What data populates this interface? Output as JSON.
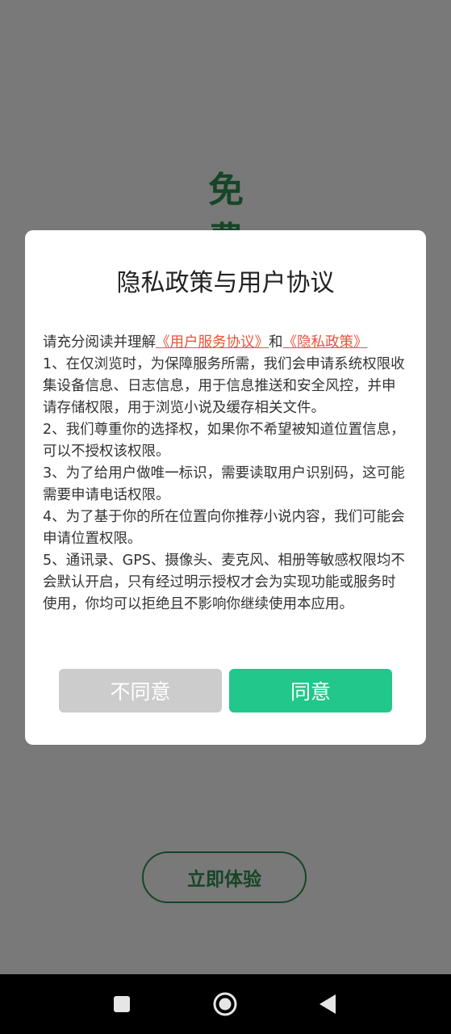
{
  "background": {
    "title": "免费",
    "cta_label": "立即体验"
  },
  "dialog": {
    "title": "隐私政策与用户协议",
    "intro_prefix": "请充分阅读并理解",
    "user_agreement_link": "《用户服务协议》",
    "conjunction": "和",
    "privacy_policy_link": "《隐私政策》",
    "items": [
      "1、在仅浏览时，为保障服务所需，我们会申请系统权限收集设备信息、日志信息，用于信息推送和安全风控，并申请存储权限，用于浏览小说及缓存相关文件。",
      "2、我们尊重你的选择权，如果你不希望被知道位置信息，可以不授权该权限。",
      "3、为了给用户做唯一标识，需要读取用户识别码，这可能需要申请电话权限。",
      "4、为了基于你的所在位置向你推荐小说内容，我们可能会申请位置权限。",
      "5、通讯录、GPS、摄像头、麦克风、相册等敏感权限均不会默认开启，只有经过明示授权才会为实现功能或服务时使用，你均可以拒绝且不影响你继续使用本应用。"
    ],
    "disagree_label": "不同意",
    "agree_label": "同意"
  },
  "navbar": {
    "recents_icon": "square-icon",
    "home_icon": "circle-home-icon",
    "back_icon": "triangle-back-icon"
  },
  "colors": {
    "accent": "#21c78b",
    "link": "#e8533b",
    "brand_green": "#2d8a4f",
    "disabled_button": "#cccccc"
  }
}
